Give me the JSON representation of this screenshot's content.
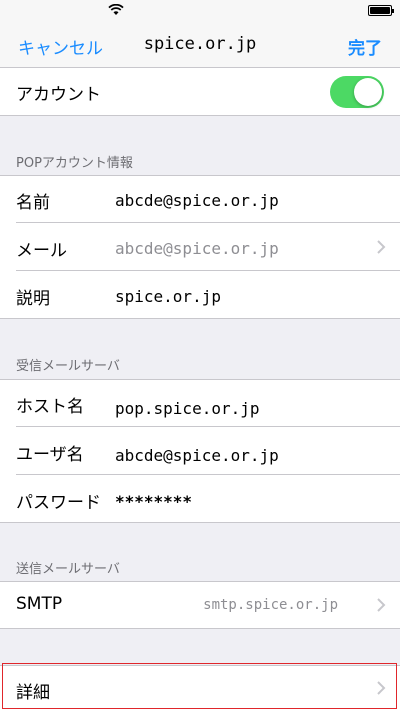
{
  "nav": {
    "cancel_label": "キャンセル",
    "title": "spice.or.jp",
    "done_label": "完了"
  },
  "account_row": {
    "label": "アカウント",
    "toggle_on": true
  },
  "pop_section": {
    "header": "POPアカウント情報",
    "rows": [
      {
        "label": "名前",
        "value": "abcde@spice.or.jp"
      },
      {
        "label": "メール",
        "value": "abcde@spice.or.jp"
      },
      {
        "label": "説明",
        "value": "spice.or.jp"
      }
    ]
  },
  "incoming_section": {
    "header": "受信メールサーバ",
    "rows": [
      {
        "label": "ホスト名",
        "value": "pop.spice.or.jp"
      },
      {
        "label": "ユーザ名",
        "value": "abcde@spice.or.jp"
      },
      {
        "label": "パスワード",
        "value": "********"
      }
    ]
  },
  "outgoing_section": {
    "header": "送信メールサーバ",
    "smtp": {
      "label": "SMTP",
      "value": "smtp.spice.or.jp"
    }
  },
  "advanced_row": {
    "label": "詳細"
  },
  "colors": {
    "accent": "#1a8cff",
    "toggle_on": "#4cd964",
    "background": "#efeff4",
    "highlight": "#e0262b"
  },
  "icons": [
    "wifi-icon",
    "battery-icon",
    "chevron-right-icon"
  ]
}
